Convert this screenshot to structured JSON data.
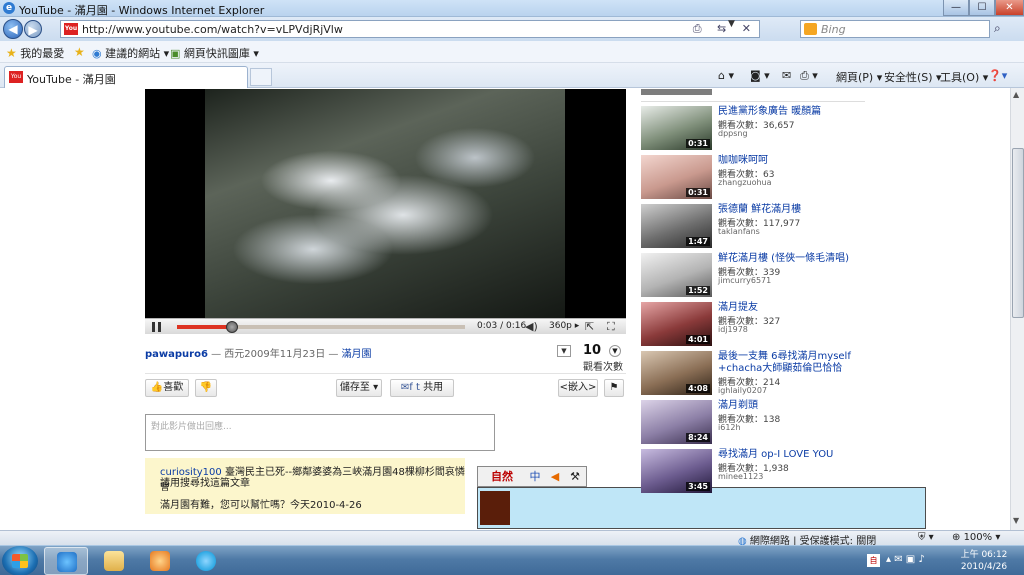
{
  "window": {
    "title": "YouTube - 滿月園 - Windows Internet Explorer"
  },
  "address": {
    "url": "http://www.youtube.com/watch?v=vLPVdjRjVlw"
  },
  "search": {
    "placeholder": "Bing"
  },
  "favorites": {
    "favorites_label": "我的最愛",
    "suggested_sites": "建議的網站 ▾",
    "web_slice": "網頁快訊圖庫 ▾"
  },
  "tab": {
    "label": "YouTube - 滿月園"
  },
  "commands": {
    "page": "網頁(P) ▾",
    "safety": "安全性(S) ▾",
    "tools": "工具(O) ▾"
  },
  "player": {
    "time": "0:03 / 0:16",
    "quality": "360p",
    "progress_fraction": 0.19
  },
  "info": {
    "uploader": "pawapuro6",
    "date": " — 西元2009年11月23日 — ",
    "link": "滿月園",
    "views": "10",
    "views_label": "觀看次數"
  },
  "actions": {
    "like": "喜歡",
    "save_to": "儲存至",
    "share": "共用",
    "embed": "<嵌入>"
  },
  "comment": {
    "placeholder": "對此影片做出回應..."
  },
  "notice": {
    "user": "curiosity100",
    "line1": " 臺灣民主已死--鄉鄰婆婆為三峽滿月園48棵柳杉閻哀憐會",
    "line2": "請用搜尋找這篇文章",
    "line3": "滿月園有難，您可以幫忙嗎？今天2010-4-26"
  },
  "sidebar": [
    {
      "title": "民進黨形象廣告 暖顏篇",
      "views": "觀看次數：36,657",
      "user": "dppsng",
      "duration": "0:31"
    },
    {
      "title": "咖咖咪呵呵",
      "views": "觀看次數：63",
      "user": "zhangzuohua",
      "duration": "0:31"
    },
    {
      "title": "張德蘭 鮮花滿月樓",
      "views": "觀看次數：117,977",
      "user": "taklanfans",
      "duration": "1:47"
    },
    {
      "title": "鮮花滿月樓 (怪俠一條毛清唱)",
      "views": "觀看次數：339",
      "user": "jimcurry6571",
      "duration": "1:52"
    },
    {
      "title": "滿月提友",
      "views": "觀看次數：327",
      "user": "idj1978",
      "duration": "4:01"
    },
    {
      "title": "最後一支舞 6尋找滿月myself +chacha大師顯茹倫巴恰恰",
      "views": "觀看次數：214",
      "user": "ighlaily0207",
      "duration": "4:08"
    },
    {
      "title": "滿月剃頭",
      "views": "觀看次數：138",
      "user": "i612h",
      "duration": "8:24"
    },
    {
      "title": "尋找滿月 op-I LOVE YOU",
      "views": "觀看次數：1,938",
      "user": "minee1123",
      "duration": "3:45"
    }
  ],
  "statusbar": {
    "zone": "網際網路 | 受保護模式: 關閉",
    "zoom": "100%"
  },
  "taskbar": {
    "time": "上午 06:12",
    "date": "2010/4/26"
  }
}
